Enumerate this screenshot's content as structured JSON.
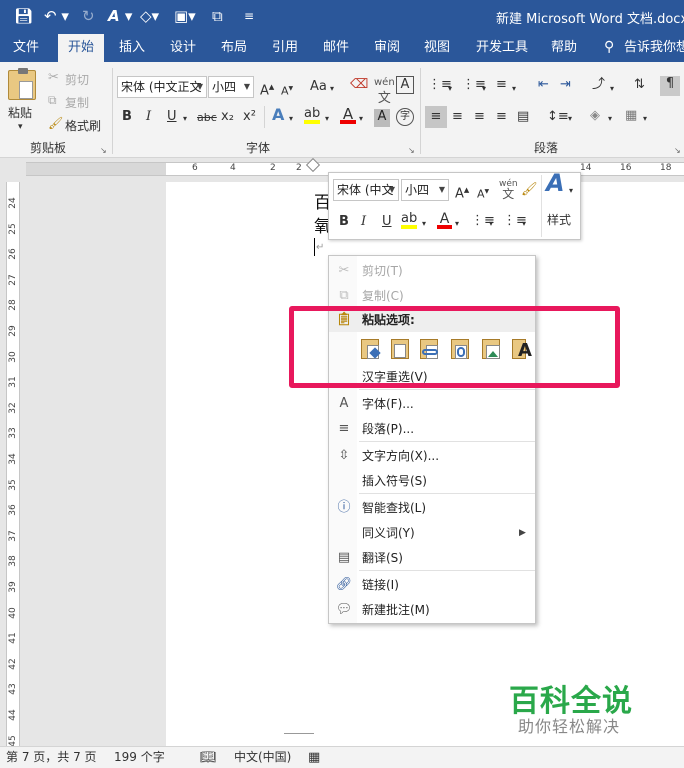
{
  "title": "新建 Microsoft Word 文档.docx [",
  "qat": {
    "save_icon": "save-icon",
    "undo_icon": "undo-icon",
    "redo_icon": "redo-icon"
  },
  "tabs": [
    "文件",
    "开始",
    "插入",
    "设计",
    "布局",
    "引用",
    "邮件",
    "审阅",
    "视图",
    "开发工具",
    "帮助",
    "告诉我你想"
  ],
  "active_tab": "开始",
  "ribbon": {
    "clipboard": {
      "paste": "粘贴",
      "cut": "剪切",
      "copy": "复制",
      "format_painter": "格式刷",
      "label": "剪贴板"
    },
    "font": {
      "name": "宋体 (中文正文",
      "size": "小四",
      "label": "字体",
      "aa": "Aa",
      "bold": "B",
      "italic": "I",
      "underline": "U",
      "strike": "abc",
      "sub": "x₂",
      "sup": "x²",
      "a_text": "A"
    },
    "paragraph": {
      "label": "段落"
    },
    "styles_label": "样式"
  },
  "ruler_h": [
    "6",
    "4",
    "2",
    "2",
    "14",
    "16",
    "18"
  ],
  "ruler_v": [
    "24",
    "25",
    "26",
    "27",
    "28",
    "29",
    "30",
    "31",
    "32",
    "33",
    "34",
    "35",
    "36",
    "37",
    "38",
    "39",
    "40",
    "41",
    "42",
    "43",
    "44",
    "45"
  ],
  "doc_text": [
    "百",
    "氧"
  ],
  "minibar": {
    "font": "宋体 (中文",
    "size": "小四",
    "styles": "样式",
    "bold": "B",
    "italic": "I",
    "underline": "U"
  },
  "context_menu": {
    "cut": "剪切(T)",
    "copy": "复制(C)",
    "paste_options": "粘贴选项:",
    "reconvert": "汉字重选(V)",
    "font": "字体(F)...",
    "paragraph": "段落(P)...",
    "text_direction": "文字方向(X)...",
    "insert_symbol": "插入符号(S)",
    "smart_lookup": "智能查找(L)",
    "synonyms": "同义词(Y)",
    "translate": "翻译(S)",
    "link": "链接(I)",
    "new_comment": "新建批注(M)"
  },
  "status": {
    "page": "第 7 页，共 7 页",
    "words": "199 个字",
    "lang": "中文(中国)"
  },
  "watermark": {
    "title": "百科全说",
    "sub": "助你轻松解决"
  },
  "colors": {
    "brand": "#2b579a",
    "highlight": "#e8185c",
    "watermark": "#2aa84a"
  }
}
